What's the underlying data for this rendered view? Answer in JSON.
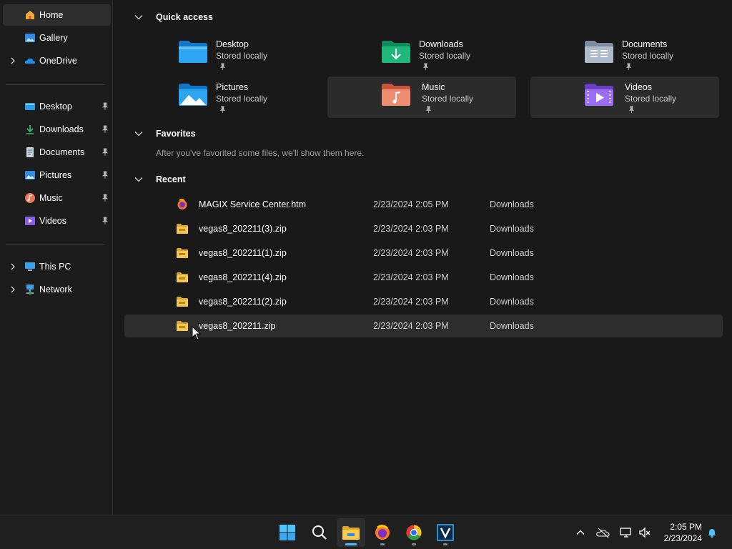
{
  "sidebar": {
    "top_items": [
      {
        "label": "Home",
        "icon": "home-icon"
      },
      {
        "label": "Gallery",
        "icon": "gallery-icon"
      },
      {
        "label": "OneDrive",
        "icon": "onedrive-icon"
      }
    ],
    "pinned_items": [
      {
        "label": "Desktop",
        "icon": "desktop-folder-icon"
      },
      {
        "label": "Downloads",
        "icon": "downloads-icon"
      },
      {
        "label": "Documents",
        "icon": "documents-icon"
      },
      {
        "label": "Pictures",
        "icon": "pictures-icon"
      },
      {
        "label": "Music",
        "icon": "music-icon"
      },
      {
        "label": "Videos",
        "icon": "videos-icon"
      }
    ],
    "bottom_items": [
      {
        "label": "This PC",
        "icon": "this-pc-icon"
      },
      {
        "label": "Network",
        "icon": "network-icon"
      }
    ]
  },
  "main": {
    "quick_access": {
      "title": "Quick access",
      "tiles": [
        {
          "name": "Desktop",
          "sub": "Stored locally",
          "icon": "desktop-folder-icon"
        },
        {
          "name": "Downloads",
          "sub": "Stored locally",
          "icon": "downloads-folder-icon"
        },
        {
          "name": "Documents",
          "sub": "Stored locally",
          "icon": "documents-folder-icon"
        },
        {
          "name": "Pictures",
          "sub": "Stored locally",
          "icon": "pictures-folder-icon"
        },
        {
          "name": "Music",
          "sub": "Stored locally",
          "icon": "music-folder-icon"
        },
        {
          "name": "Videos",
          "sub": "Stored locally",
          "icon": "videos-folder-icon"
        }
      ]
    },
    "favorites": {
      "title": "Favorites",
      "empty_message": "After you've favorited some files, we'll show them here."
    },
    "recent": {
      "title": "Recent",
      "rows": [
        {
          "name": "MAGIX Service Center.htm",
          "date": "2/23/2024 2:05 PM",
          "location": "Downloads",
          "icon": "firefox-html-icon"
        },
        {
          "name": "vegas8_202211(3).zip",
          "date": "2/23/2024 2:03 PM",
          "location": "Downloads",
          "icon": "zip-folder-icon"
        },
        {
          "name": "vegas8_202211(1).zip",
          "date": "2/23/2024 2:03 PM",
          "location": "Downloads",
          "icon": "zip-folder-icon"
        },
        {
          "name": "vegas8_202211(4).zip",
          "date": "2/23/2024 2:03 PM",
          "location": "Downloads",
          "icon": "zip-folder-icon"
        },
        {
          "name": "vegas8_202211(2).zip",
          "date": "2/23/2024 2:03 PM",
          "location": "Downloads",
          "icon": "zip-folder-icon"
        },
        {
          "name": "vegas8_202211.zip",
          "date": "2/23/2024 2:03 PM",
          "location": "Downloads",
          "icon": "zip-folder-icon"
        }
      ]
    }
  },
  "taskbar": {
    "apps": [
      "start-icon",
      "search-icon",
      "file-explorer-icon",
      "firefox-icon",
      "chrome-icon",
      "vegas-icon"
    ],
    "clock_time": "2:05 PM",
    "clock_date": "2/23/2024"
  },
  "colors": {
    "accent": "#4cc2ff",
    "folder_blue": "#1e9be6",
    "folder_green": "#1ea672",
    "folder_music": "#e8775a",
    "folder_video": "#8a5ce6",
    "zip_yellow": "#f2c94c"
  }
}
